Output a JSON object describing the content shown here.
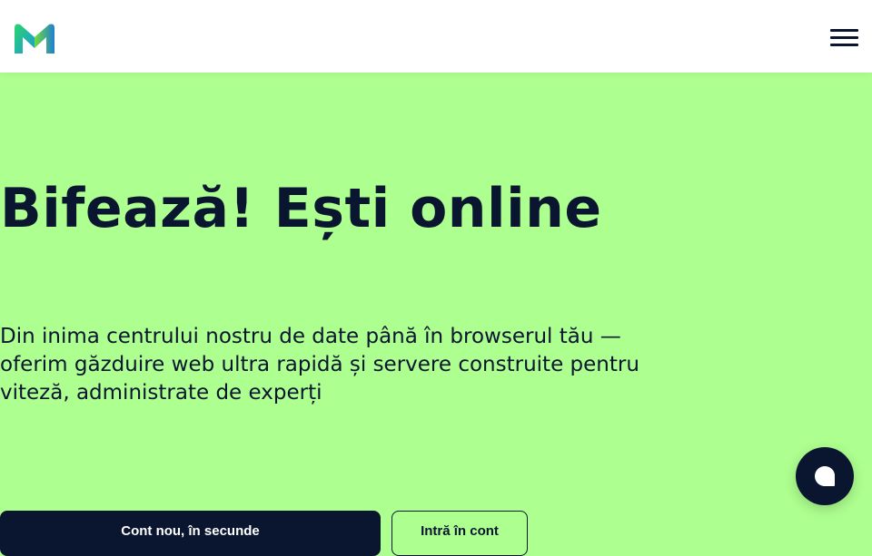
{
  "header": {
    "logo_icon": "m-logo-icon",
    "menu_icon": "hamburger-menu-icon"
  },
  "hero": {
    "title": "Bifează! Ești online",
    "subtitle": "Din inima centrului nostru de date până în browserul tău — oferim găzduire web ultra rapidă și servere construite pentru viteză, administrate de experți",
    "primary_button": "Cont nou, în secunde",
    "secondary_button": "Intră în cont"
  },
  "chat": {
    "icon": "chat-bubble-icon"
  },
  "colors": {
    "background": "#adff8f",
    "dark": "#0a1530",
    "header": "#ffffff"
  }
}
